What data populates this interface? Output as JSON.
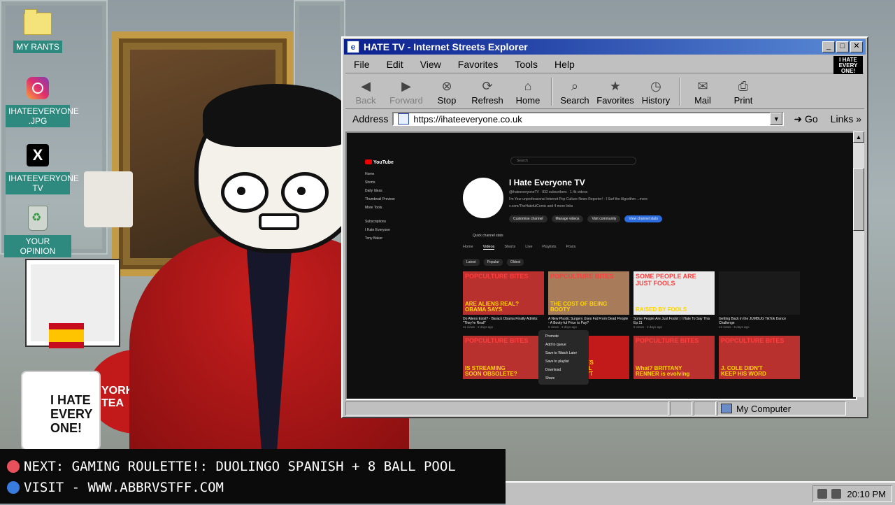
{
  "desktop": {
    "icons": [
      {
        "label": "MY RANTS"
      },
      {
        "label": "IHATEEVERYONE .JPG"
      },
      {
        "label": "IHATEEVERYONE TV"
      },
      {
        "label": "YOUR OPINION"
      }
    ]
  },
  "props": {
    "mug_text": "I HATE EVERY ONE!",
    "tin_text": "YORKSHIRE TEA"
  },
  "window": {
    "title": "HATE TV - Internet Streets Explorer",
    "brand": "I HATE EVERY ONE!",
    "menu": [
      "File",
      "Edit",
      "View",
      "Favorites",
      "Tools",
      "Help"
    ],
    "toolbar": [
      {
        "label": "Back",
        "icon": "back-arrow-icon",
        "enabled": false
      },
      {
        "label": "Forward",
        "icon": "forward-arrow-icon",
        "enabled": false
      },
      {
        "label": "Stop",
        "icon": "stop-icon",
        "enabled": true
      },
      {
        "label": "Refresh",
        "icon": "refresh-icon",
        "enabled": true
      },
      {
        "label": "Home",
        "icon": "home-icon",
        "enabled": true
      },
      {
        "label": "Search",
        "icon": "search-icon",
        "enabled": true
      },
      {
        "label": "Favorites",
        "icon": "favorites-icon",
        "enabled": true
      },
      {
        "label": "History",
        "icon": "history-icon",
        "enabled": true
      },
      {
        "label": "Mail",
        "icon": "mail-icon",
        "enabled": true
      },
      {
        "label": "Print",
        "icon": "print-icon",
        "enabled": true
      }
    ],
    "address_label": "Address",
    "address_value": "https://ihateeveryone.co.uk",
    "go_label": "Go",
    "links_label": "Links",
    "status_zone": "My Computer"
  },
  "youtube": {
    "logo": "YouTube",
    "search_placeholder": "Search",
    "sidebar": [
      "Home",
      "Shorts",
      "Daily Ideas",
      "Thumbnail Preview",
      "More Tools",
      "Subscriptions",
      "I Hate Everyone",
      "Tony Baker"
    ],
    "channel_name": "I Hate Everyone TV",
    "channel_handle": "@ihateeveryoneTV · 832 subscribers · 1.4k videos",
    "channel_desc": "I'm Your unprofessional Internet Pop Culture News Reporter! - I Surf the Algorithm ...more",
    "channel_links": "x.com/TheHatefulComic and 4 more links",
    "buttons": [
      "Customise channel",
      "Manage videos",
      "Visit community",
      "View channel stats"
    ],
    "quick_stats": "Quick channel stats",
    "tabs": [
      "Home",
      "Videos",
      "Shorts",
      "Live",
      "Playlists",
      "Posts"
    ],
    "active_tab": "Videos",
    "chips": [
      "Latest",
      "Popular",
      "Oldest"
    ],
    "videos": [
      {
        "top": "POPCULTURE BITES",
        "caption": "ARE ALIENS REAL? OBAMA SAYS",
        "title": "Do Aliens Exist? - Barack Obama Finally Admits: \"They're Real!\"",
        "meta": "11 views · 2 days ago",
        "bg": "#b8312f"
      },
      {
        "top": "POPCULTURE BITES",
        "caption": "THE COST OF BEING BOOTY",
        "title": "A New Plastic Surgery Uses Fat From Dead People - A Booty-ful Price to Pay?",
        "meta": "6 views · 3 days ago",
        "bg": "#a87c5a"
      },
      {
        "top": "SOME PEOPLE ARE JUST FOOLS",
        "caption": "RAISED BY FOOLS",
        "title": "Some People Are Just Fools! | I Hate To Say This Ep.11",
        "meta": "5 views · 3 days ago",
        "bg": "#e9e9e9"
      },
      {
        "top": "",
        "caption": "",
        "title": "Getting Back in the JUMBUG TikTok Dance Challenge",
        "meta": "13 views · 5 days ago",
        "bg": "#1a1a1a"
      },
      {
        "top": "POPCULTURE BITES",
        "caption": "IS STREAMING SOON OBSOLETE?",
        "title": "",
        "meta": "",
        "bg": "#b8312f"
      },
      {
        "top": "",
        "caption": "GOD FORGIVES BUT... I'M STILL HUMAN I DON'T",
        "title": "",
        "meta": "",
        "bg": "#c21a1a"
      },
      {
        "top": "POPCULTURE BITES",
        "caption": "What? BRITTANY RENNER is evolving",
        "title": "",
        "meta": "",
        "bg": "#b8312f"
      },
      {
        "top": "POPCULTURE BITES",
        "caption": "J. COLE DIDN'T KEEP HIS WORD",
        "title": "",
        "meta": "",
        "bg": "#b8312f"
      }
    ],
    "context_menu": [
      "Promote",
      "Add to queue",
      "Save to Watch Later",
      "Save to playlist",
      "Download",
      "Share"
    ]
  },
  "ticker": {
    "next": "NEXT: GAMING ROULETTE!: DUOLINGO SPANISH + 8 BALL POOL",
    "visit": "VISIT - WWW.ABBRVSTFF.COM",
    "next_dot": "#e8505b",
    "visit_dot": "#3a7be0"
  },
  "taskbar": {
    "clock": "20:10 PM"
  },
  "colors": {
    "title_start": "#0a1f8f",
    "title_end": "#5a8bd6",
    "desktop_label": "#2e8a7e"
  }
}
